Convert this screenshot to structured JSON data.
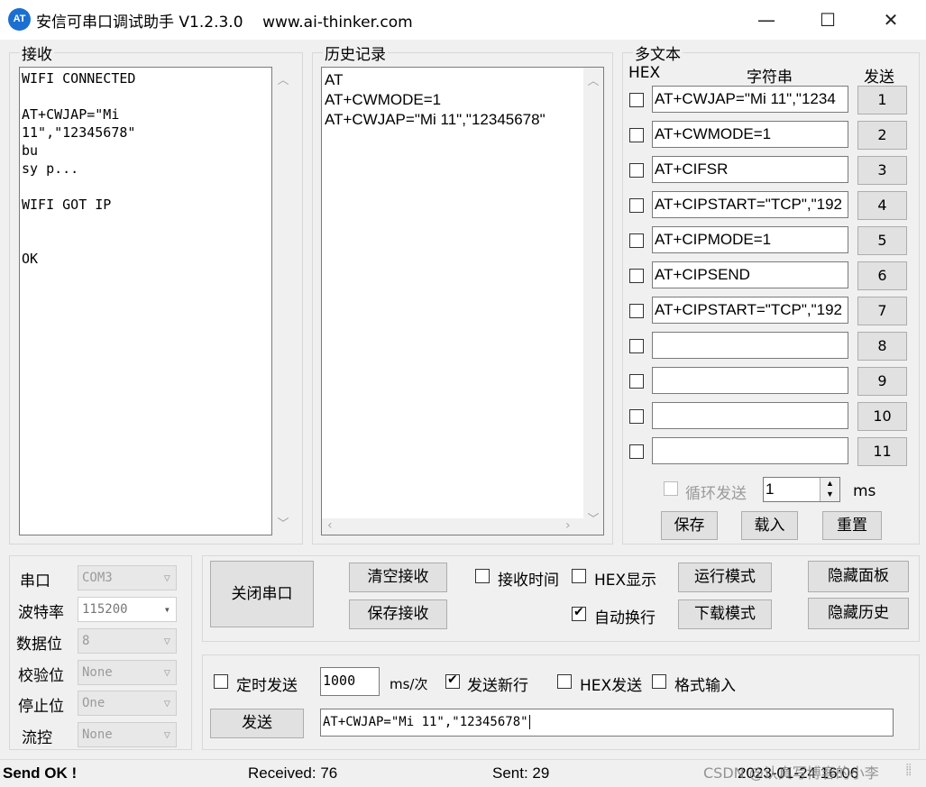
{
  "window": {
    "logo_text": "AT",
    "title": "安信可串口调试助手 V1.2.3.0    www.ai-thinker.com",
    "minimize": "—",
    "maximize": "☐",
    "close": "✕"
  },
  "receive": {
    "label": "接收",
    "text": "WIFI CONNECTED\n\nAT+CWJAP=\"Mi\n11\",\"12345678\"\nbu\nsy p...\n\nWIFI GOT IP\n\n\nOK"
  },
  "history": {
    "label": "历史记录",
    "items": [
      "AT",
      "AT+CWMODE=1",
      "AT+CWJAP=\"Mi 11\",\"12345678\""
    ]
  },
  "multi": {
    "label": "多文本",
    "hex_header": "HEX",
    "string_header": "字符串",
    "send_header": "发送",
    "rows": [
      {
        "value": "AT+CWJAP=\"Mi 11\",\"1234",
        "num": "1"
      },
      {
        "value": "AT+CWMODE=1",
        "num": "2"
      },
      {
        "value": "AT+CIFSR",
        "num": "3"
      },
      {
        "value": "AT+CIPSTART=\"TCP\",\"192",
        "num": "4"
      },
      {
        "value": "AT+CIPMODE=1",
        "num": "5"
      },
      {
        "value": "AT+CIPSEND",
        "num": "6"
      },
      {
        "value": "AT+CIPSTART=\"TCP\",\"192",
        "num": "7"
      },
      {
        "value": "",
        "num": "8"
      },
      {
        "value": "",
        "num": "9"
      },
      {
        "value": "",
        "num": "10"
      },
      {
        "value": "",
        "num": "11"
      }
    ],
    "loop_send_label": "循环发送",
    "loop_interval": "1",
    "ms_label": "ms",
    "save_label": "保存",
    "load_label": "载入",
    "reset_label": "重置"
  },
  "port": {
    "port_label": "串口",
    "port_value": "COM3",
    "baud_label": "波特率",
    "baud_value": "115200",
    "data_label": "数据位",
    "data_value": "8",
    "parity_label": "校验位",
    "parity_value": "None",
    "stop_label": "停止位",
    "stop_value": "One",
    "flow_label": "流控",
    "flow_value": "None"
  },
  "controls": {
    "close_port": "关闭串口",
    "clear_receive": "清空接收",
    "save_receive": "保存接收",
    "receive_time": "接收时间",
    "hex_display": "HEX显示",
    "auto_wrap": "自动换行",
    "run_mode": "运行模式",
    "download_mode": "下载模式",
    "hide_panel": "隐藏面板",
    "hide_history": "隐藏历史"
  },
  "send": {
    "timed_send": "定时发送",
    "interval": "1000",
    "interval_unit": "ms/次",
    "send_newline": "发送新行",
    "hex_send": "HEX发送",
    "format_input": "格式输入",
    "send_button": "发送",
    "input_value": "AT+CWJAP=\"Mi 11\",\"12345678\""
  },
  "statusbar": {
    "send_ok": "Send OK !",
    "received": "Received: 76",
    "sent": "Sent: 29",
    "datetime": "2023-01-24 16:06",
    "watermark": "CSDN @认真写博客的小李"
  }
}
